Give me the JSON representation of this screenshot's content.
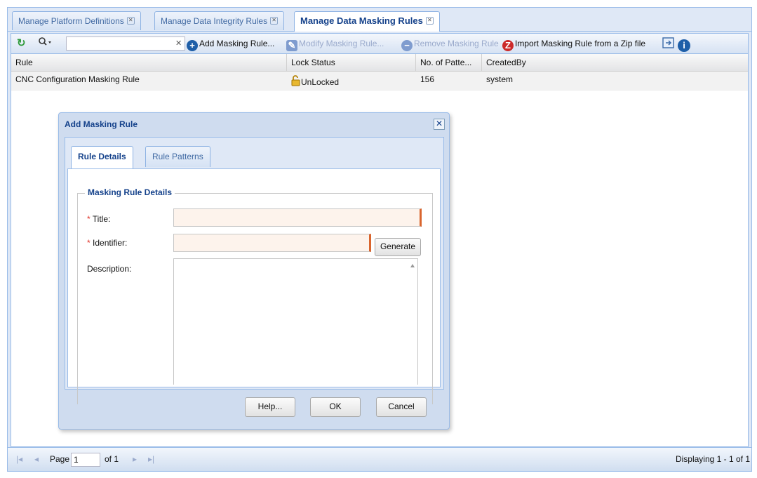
{
  "tabs": [
    {
      "label": "Manage Platform Definitions",
      "active": false
    },
    {
      "label": "Manage Data Integrity Rules",
      "active": false
    },
    {
      "label": "Manage Data Masking Rules",
      "active": true
    }
  ],
  "toolbar": {
    "search_value": "",
    "add_label": "Add Masking Rule...",
    "modify_label": "Modify Masking Rule...",
    "remove_label": "Remove Masking Rule",
    "import_label": "Import Masking Rule from a Zip file"
  },
  "grid": {
    "columns": [
      "Rule",
      "Lock Status",
      "No. of Patte...",
      "CreatedBy"
    ],
    "rows": [
      {
        "rule": "CNC Configuration Masking Rule",
        "lock_status": "UnLocked",
        "patterns": "156",
        "created_by": "system"
      }
    ]
  },
  "pager": {
    "page_label": "Page",
    "page_value": "1",
    "of_label": "of 1",
    "display": "Displaying 1 - 1 of 1"
  },
  "dialog": {
    "title": "Add Masking Rule",
    "tabs": [
      "Rule Details",
      "Rule Patterns"
    ],
    "fieldset_legend": "Masking Rule Details",
    "title_label": "Title:",
    "identifier_label": "Identifier:",
    "description_label": "Description:",
    "required_mark": "*",
    "generate_label": "Generate",
    "help_label": "Help...",
    "ok_label": "OK",
    "cancel_label": "Cancel"
  },
  "colors": {
    "accent_border": "#99bbe8",
    "title_blue": "#15428b",
    "required_red": "#e0352b",
    "invalid_orange": "#d9652e"
  }
}
